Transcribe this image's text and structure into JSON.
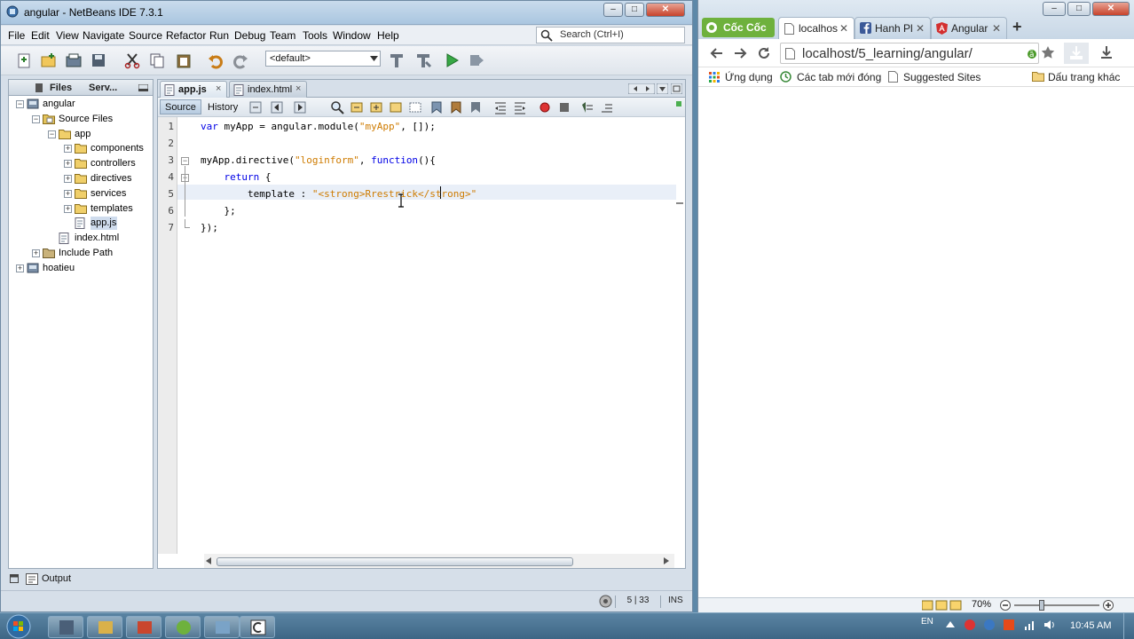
{
  "netbeans": {
    "title": "angular - NetBeans IDE 7.3.1",
    "window_controls": {
      "minimize": "–",
      "restore": "□",
      "close": "✕"
    },
    "menu": [
      "File",
      "Edit",
      "View",
      "Navigate",
      "Source",
      "Refactor",
      "Run",
      "Debug",
      "Team",
      "Tools",
      "Window",
      "Help"
    ],
    "search_placeholder": "Search (Ctrl+I)",
    "config_select": "<default>",
    "files_panel": {
      "tabs": [
        "Files",
        "Serv..."
      ],
      "tree": [
        {
          "label": "angular",
          "level": 0,
          "icon": "project-icon",
          "expanded": true
        },
        {
          "label": "Source Files",
          "level": 1,
          "icon": "source-folder-icon",
          "expanded": true
        },
        {
          "label": "app",
          "level": 2,
          "icon": "folder-icon",
          "expanded": true
        },
        {
          "label": "components",
          "level": 3,
          "icon": "folder-icon",
          "expanded": false
        },
        {
          "label": "controllers",
          "level": 3,
          "icon": "folder-icon",
          "expanded": false
        },
        {
          "label": "directives",
          "level": 3,
          "icon": "folder-icon",
          "expanded": false
        },
        {
          "label": "services",
          "level": 3,
          "icon": "folder-icon",
          "expanded": false
        },
        {
          "label": "templates",
          "level": 3,
          "icon": "folder-icon",
          "expanded": false
        },
        {
          "label": "app.js",
          "level": 3,
          "icon": "js-file-icon",
          "selected": true
        },
        {
          "label": "index.html",
          "level": 2,
          "icon": "html-file-icon"
        },
        {
          "label": "Include Path",
          "level": 1,
          "icon": "include-path-icon",
          "expanded": false
        },
        {
          "label": "hoatieu",
          "level": 0,
          "icon": "project-icon",
          "expanded": false
        }
      ]
    },
    "editor": {
      "tabs": [
        {
          "label": "app.js",
          "active": true
        },
        {
          "label": "index.html",
          "active": false
        }
      ],
      "view_buttons": {
        "source": "Source",
        "history": "History"
      },
      "line_numbers": [
        "1",
        "2",
        "3",
        "4",
        "5",
        "6",
        "7"
      ],
      "lines": [
        [
          {
            "t": "var ",
            "c": "kw"
          },
          {
            "t": "myApp = angular.module(",
            "c": "fn"
          },
          {
            "t": "\"myApp\"",
            "c": "str"
          },
          {
            "t": ", []);",
            "c": "fn"
          }
        ],
        [],
        [
          {
            "t": "myApp.directive(",
            "c": "fn"
          },
          {
            "t": "\"loginform\"",
            "c": "str"
          },
          {
            "t": ", ",
            "c": "fn"
          },
          {
            "t": "function",
            "c": "kw"
          },
          {
            "t": "(){",
            "c": "fn"
          }
        ],
        [
          {
            "t": "    return ",
            "c": "kw"
          },
          {
            "t": "{",
            "c": "fn"
          }
        ],
        [
          {
            "t": "        template : ",
            "c": "fn"
          },
          {
            "t": "\"<strong>Rrestrick</strong>\"",
            "c": "str"
          }
        ],
        [
          {
            "t": "    };",
            "c": "fn"
          }
        ],
        [
          {
            "t": "});",
            "c": "fn"
          }
        ]
      ]
    },
    "output_label": "Output",
    "status": {
      "position": "5 | 33",
      "mode": "INS"
    }
  },
  "browser": {
    "brand": "Cốc Cốc",
    "tabs": [
      {
        "label": "localhos",
        "active": true,
        "icon": "page-icon"
      },
      {
        "label": "Hanh Pl",
        "active": false,
        "icon": "facebook-icon"
      },
      {
        "label": "Angular",
        "active": false,
        "icon": "angular-icon"
      }
    ],
    "new_tab": "+",
    "url": "localhost/5_learning/angular/",
    "bookmarks": [
      {
        "label": "Ứng dụng",
        "icon": "apps-icon"
      },
      {
        "label": "Các tab mới đóng",
        "icon": "recent-icon"
      },
      {
        "label": "Suggested Sites",
        "icon": "page-icon"
      }
    ],
    "other_bookmarks": "Dấu trang khác",
    "zoom": "70%"
  },
  "taskbar": {
    "lang": "EN",
    "time": "10:45 AM"
  },
  "colors": {
    "keyword": "#0000e6",
    "string": "#ce7b00",
    "brand_green": "#6eb13d"
  }
}
